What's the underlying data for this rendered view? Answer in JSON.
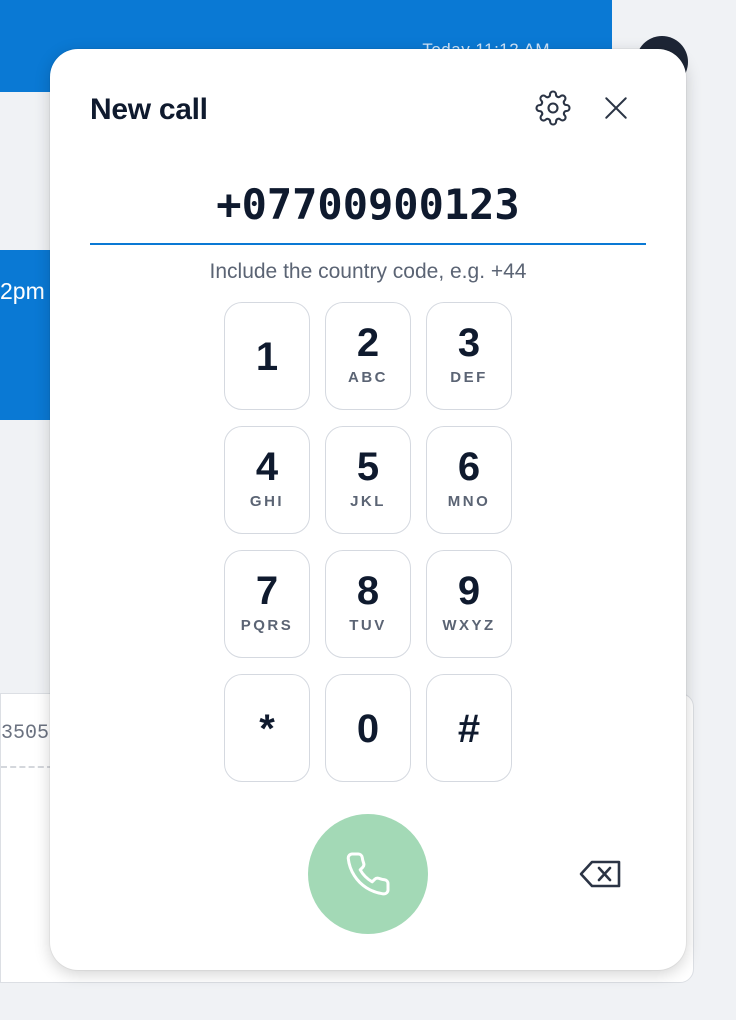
{
  "background": {
    "top_time": "Today 11:12 AM",
    "mid_time": "2pm",
    "card_number": "3505"
  },
  "modal": {
    "title": "New call",
    "phone_number": "+07700900123",
    "hint": "Include the country code, e.g. +44",
    "icons": {
      "settings": "gear-icon",
      "close": "close-icon",
      "call": "phone-icon",
      "backspace": "backspace-icon"
    },
    "keys": [
      {
        "digit": "1",
        "letters": ""
      },
      {
        "digit": "2",
        "letters": "ABC"
      },
      {
        "digit": "3",
        "letters": "DEF"
      },
      {
        "digit": "4",
        "letters": "GHI"
      },
      {
        "digit": "5",
        "letters": "JKL"
      },
      {
        "digit": "6",
        "letters": "MNO"
      },
      {
        "digit": "7",
        "letters": "PQRS"
      },
      {
        "digit": "8",
        "letters": "TUV"
      },
      {
        "digit": "9",
        "letters": "WXYZ"
      },
      {
        "digit": "*",
        "letters": ""
      },
      {
        "digit": "0",
        "letters": ""
      },
      {
        "digit": "#",
        "letters": ""
      }
    ],
    "colors": {
      "accent": "#0a79d4",
      "call_button": "#a3d9b6",
      "text": "#0f1a2e",
      "muted": "#5b6474"
    }
  }
}
